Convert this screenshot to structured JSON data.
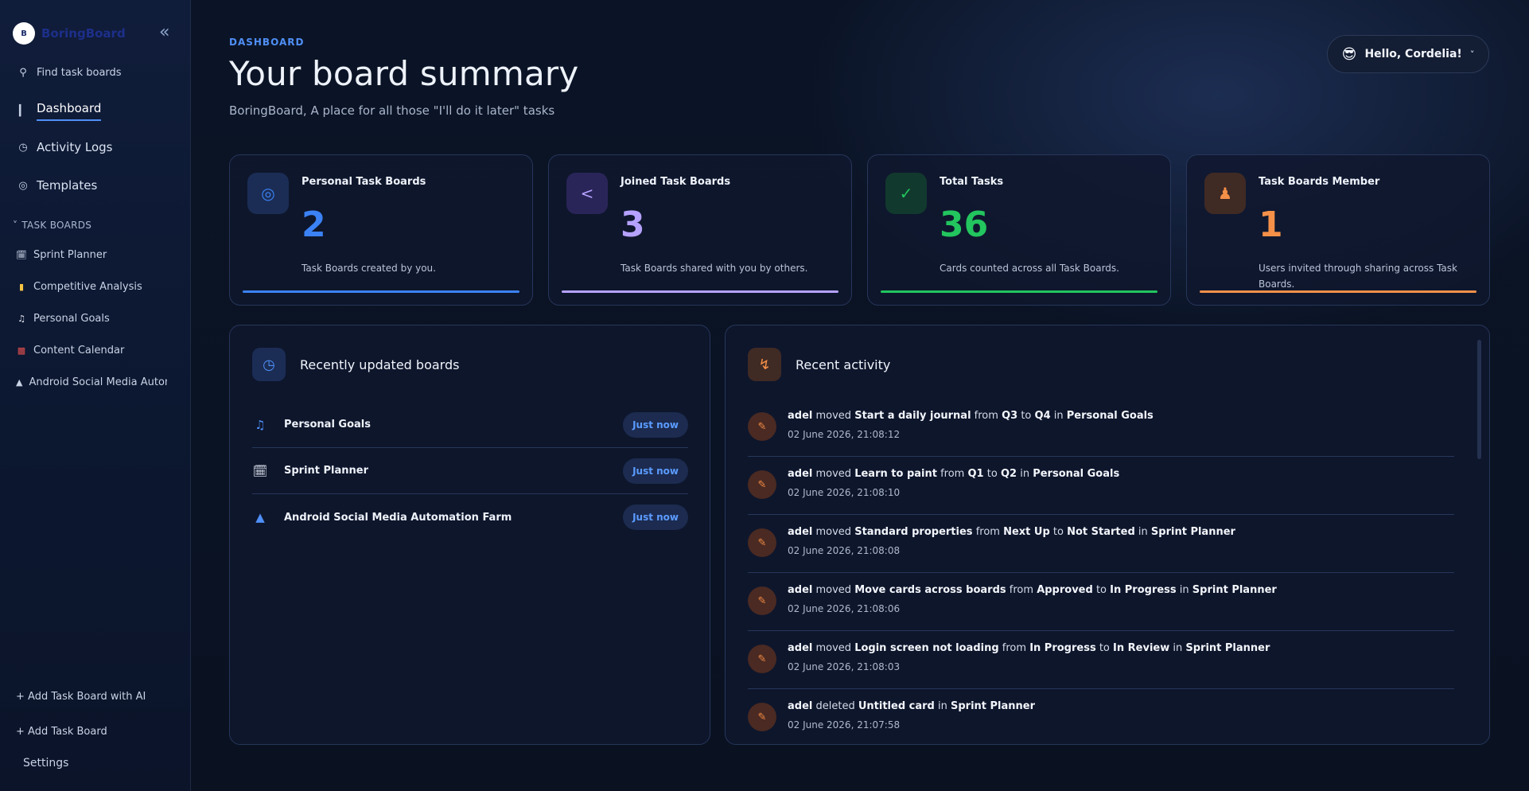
{
  "sidebar": {
    "brand": "BoringBoard",
    "logo_text": "B",
    "search_label": "Find task boards",
    "nav": {
      "dashboard": "Dashboard",
      "activity_logs": "Activity Logs",
      "templates": "Templates"
    },
    "section_title": "TASK BOARDS",
    "boards": [
      {
        "label": "Sprint Planner",
        "icon": "calendar-icon"
      },
      {
        "label": "Competitive Analysis",
        "icon": "folder-icon"
      },
      {
        "label": "Personal Goals",
        "icon": "tiktok-icon"
      },
      {
        "label": "Content Calendar",
        "icon": "calendar-icon"
      },
      {
        "label": "Android Social Media Automation Farm",
        "icon": "android-icon"
      }
    ],
    "add_ai": "+ Add Task Board with AI",
    "add_board": "+ Add Task Board",
    "settings": "Settings"
  },
  "header": {
    "crumb": "DASHBOARD",
    "title": "Your board summary",
    "subtitle": "BoringBoard, A place for all those \"I'll do it later\" tasks",
    "greeting": "Hello, Cordelia!",
    "emoji": "😎"
  },
  "stats": [
    {
      "title": "Personal Task Boards",
      "value": "2",
      "desc": "Task Boards created by you.",
      "icon": "target-icon",
      "color": "#3b82f6",
      "bg": "#1b2d55"
    },
    {
      "title": "Joined Task Boards",
      "value": "3",
      "desc": "Task Boards shared with you by others.",
      "icon": "share-icon",
      "color": "#b5a2ff",
      "bg": "#2a2558"
    },
    {
      "title": "Total Tasks",
      "value": "36",
      "desc": "Cards counted across all Task Boards.",
      "icon": "check-icon",
      "color": "#22c55e",
      "bg": "#12392e"
    },
    {
      "title": "Task Boards Member",
      "value": "1",
      "desc": "Users invited through sharing across Task Boards.",
      "icon": "users-icon",
      "color": "#f59049",
      "bg": "#402a24"
    }
  ],
  "recent_boards": {
    "title": "Recently updated boards",
    "items": [
      {
        "name": "Personal Goals",
        "time": "Just now",
        "icon": "tiktok-icon"
      },
      {
        "name": "Sprint Planner",
        "time": "Just now",
        "icon": "calendar-icon"
      },
      {
        "name": "Android Social Media Automation Farm",
        "time": "Just now",
        "icon": "android-icon"
      }
    ]
  },
  "activity": {
    "title": "Recent activity",
    "items": [
      {
        "user": "adel",
        "action": "moved",
        "card": "Start a daily journal",
        "from": "Q3",
        "to": "Q4",
        "board": "Personal Goals",
        "date": "02 June 2026, 21:08:12"
      },
      {
        "user": "adel",
        "action": "moved",
        "card": "Learn to paint",
        "from": "Q1",
        "to": "Q2",
        "board": "Personal Goals",
        "date": "02 June 2026, 21:08:10"
      },
      {
        "user": "adel",
        "action": "moved",
        "card": "Standard properties",
        "from": "Next Up",
        "to": "Not Started",
        "board": "Sprint Planner",
        "date": "02 June 2026, 21:08:08"
      },
      {
        "user": "adel",
        "action": "moved",
        "card": "Move cards across boards",
        "from": "Approved",
        "to": "In Progress",
        "board": "Sprint Planner",
        "date": "02 June 2026, 21:08:06"
      },
      {
        "user": "adel",
        "action": "moved",
        "card": "Login screen not loading",
        "from": "In Progress",
        "to": "In Review",
        "board": "Sprint Planner",
        "date": "02 June 2026, 21:08:03"
      },
      {
        "user": "adel",
        "action": "deleted",
        "card": "Untitled card",
        "board": "Sprint Planner",
        "date": "02 June 2026, 21:07:58"
      }
    ],
    "words": {
      "from": "from",
      "to": "to",
      "in": "in"
    }
  }
}
